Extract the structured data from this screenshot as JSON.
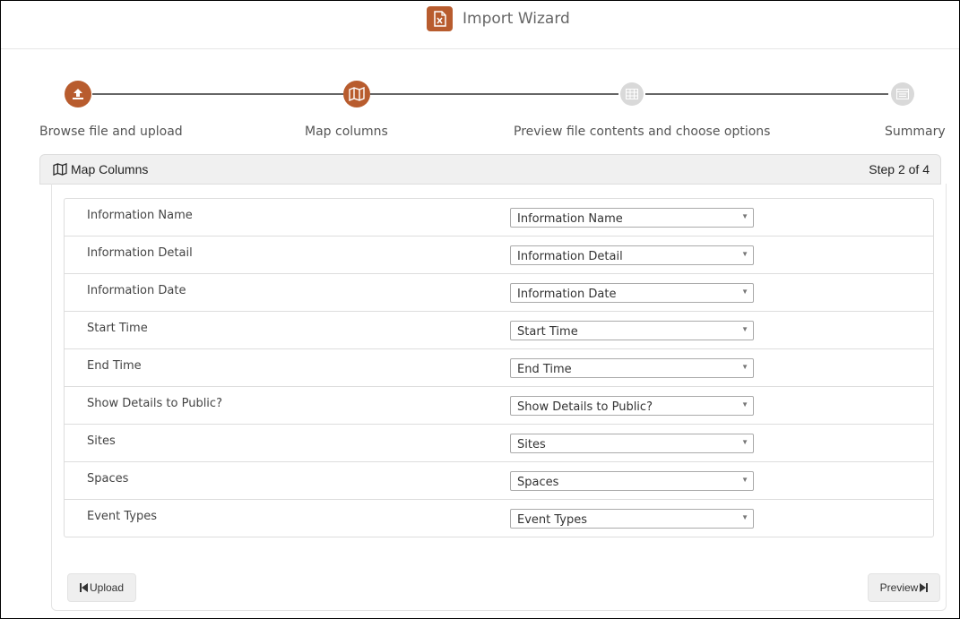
{
  "header": {
    "title": "Import Wizard",
    "icon": "excel-file-icon"
  },
  "steps": [
    {
      "label": "Browse file and upload",
      "state": "done",
      "icon": "upload-icon"
    },
    {
      "label": "Map columns",
      "state": "active",
      "icon": "map-icon"
    },
    {
      "label": "Preview file contents and choose options",
      "state": "pending",
      "icon": "table-icon"
    },
    {
      "label": "Summary",
      "state": "pending",
      "icon": "list-icon"
    }
  ],
  "panel": {
    "title": "Map Columns",
    "step_text": "Step 2 of 4",
    "icon": "map-icon"
  },
  "mappings": [
    {
      "field": "Information Name",
      "selected": "Information Name"
    },
    {
      "field": "Information Detail",
      "selected": "Information Detail"
    },
    {
      "field": "Information Date",
      "selected": "Information Date"
    },
    {
      "field": "Start Time",
      "selected": "Start Time"
    },
    {
      "field": "End Time",
      "selected": "End Time"
    },
    {
      "field": "Show Details to Public?",
      "selected": "Show Details to Public?"
    },
    {
      "field": "Sites",
      "selected": "Sites"
    },
    {
      "field": "Spaces",
      "selected": "Spaces"
    },
    {
      "field": "Event Types",
      "selected": "Event Types"
    }
  ],
  "buttons": {
    "upload_label": "Upload",
    "preview_label": "Preview"
  },
  "colors": {
    "accent": "#b85c2e",
    "pending": "#d9d9d9"
  }
}
